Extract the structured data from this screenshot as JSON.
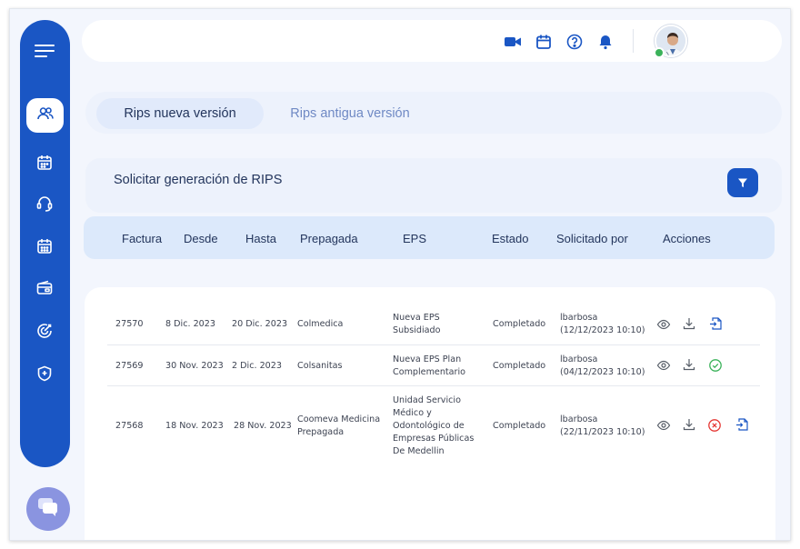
{
  "tabs": {
    "active": "Rips nueva versión",
    "inactive": "Rips antigua versión"
  },
  "request": {
    "title": "Solicitar generación de RIPS"
  },
  "table": {
    "headers": [
      "Factura",
      "Desde",
      "Hasta",
      "Prepagada",
      "EPS",
      "Estado",
      "Solicitado por",
      "Acciones"
    ],
    "rows": [
      {
        "factura": "27570",
        "desde": "8 Dic. 2023",
        "hasta": "20 Dic. 2023",
        "prepagada": [
          "Colmedica"
        ],
        "eps": [
          "Nueva EPS",
          "Subsidiado"
        ],
        "estado": "Completado",
        "solicitado_por": [
          "lbarbosa",
          "(12/12/2023 10:10)"
        ],
        "actions": [
          "eye-icon",
          "download-icon",
          "file-export-icon"
        ]
      },
      {
        "factura": "27569",
        "desde": "30 Nov. 2023",
        "hasta": "2 Dic. 2023",
        "prepagada": [
          "Colsanitas"
        ],
        "eps": [
          "Nueva EPS Plan",
          "Complementario"
        ],
        "estado": "Completado",
        "solicitado_por": [
          "lbarbosa",
          "(04/12/2023 10:10)"
        ],
        "actions": [
          "eye-icon",
          "download-icon",
          "check-circle-icon"
        ]
      },
      {
        "factura": "27568",
        "desde": "18 Nov. 2023",
        "hasta": "28 Nov. 2023",
        "prepagada": [
          "Coomeva Medicina",
          "Prepagada"
        ],
        "eps": [
          "Unidad Servicio",
          "Médico y",
          "Odontológico de",
          "Empresas Públicas",
          "De Medellin"
        ],
        "estado": "Completado",
        "solicitado_por": [
          "lbarbosa",
          "(22/11/2023 10:10)"
        ],
        "actions": [
          "eye-icon",
          "download-icon",
          "x-circle-icon",
          "file-export-icon"
        ]
      }
    ]
  },
  "colors": {
    "primary": "#1a56c4",
    "background": "#f3f6fd",
    "success": "#3bb25a",
    "danger": "#e53935",
    "text": "#23355c"
  },
  "icons": {
    "sidebar": [
      "menu-icon",
      "users-icon",
      "calendar-icon",
      "headset-icon",
      "calendar-grid-icon",
      "wallet-icon",
      "target-icon",
      "shield-icon"
    ],
    "topbar": [
      "video-icon",
      "calendar-icon",
      "help-icon",
      "bell-icon"
    ],
    "floating": "chat-icon"
  }
}
